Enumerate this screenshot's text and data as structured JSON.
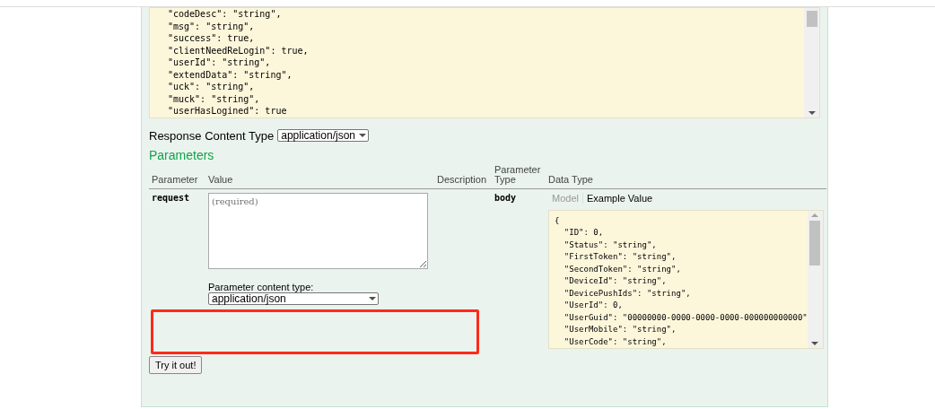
{
  "response_sample": {
    "lines": [
      "\"codeDesc\": \"string\",",
      "\"msg\": \"string\",",
      "\"success\": true,",
      "\"clientNeedReLogin\": true,",
      "\"userId\": \"string\",",
      "\"extendData\": \"string\",",
      "\"uck\": \"string\",",
      "\"muck\": \"string\",",
      "\"userHasLogined\": true"
    ]
  },
  "response_content_type": {
    "label": "Response Content Type",
    "value": "application/json"
  },
  "parameters": {
    "title": "Parameters",
    "columns": [
      "Parameter",
      "Value",
      "Description",
      "Parameter Type",
      "Data Type"
    ],
    "rows": [
      {
        "name": "request",
        "placeholder": "(required)",
        "content_type_label": "Parameter content type:",
        "content_type": "application/json",
        "parameter_type": "body",
        "data_type_tabs": [
          {
            "label": "Model",
            "selected": false
          },
          {
            "label": "Example Value",
            "selected": true
          }
        ],
        "example_lines": [
          "{",
          "  \"ID\": 0,",
          "  \"Status\": \"string\",",
          "  \"FirstToken\": \"string\",",
          "  \"SecondToken\": \"string\",",
          "  \"DeviceId\": \"string\",",
          "  \"DevicePushIds\": \"string\",",
          "  \"UserId\": 0,",
          "  \"UserGuid\": \"00000000-0000-0000-0000-000000000000\"",
          "  \"UserMobile\": \"string\",",
          "  \"UserCode\": \"string\","
        ]
      }
    ]
  },
  "try_button": "Try it out!"
}
